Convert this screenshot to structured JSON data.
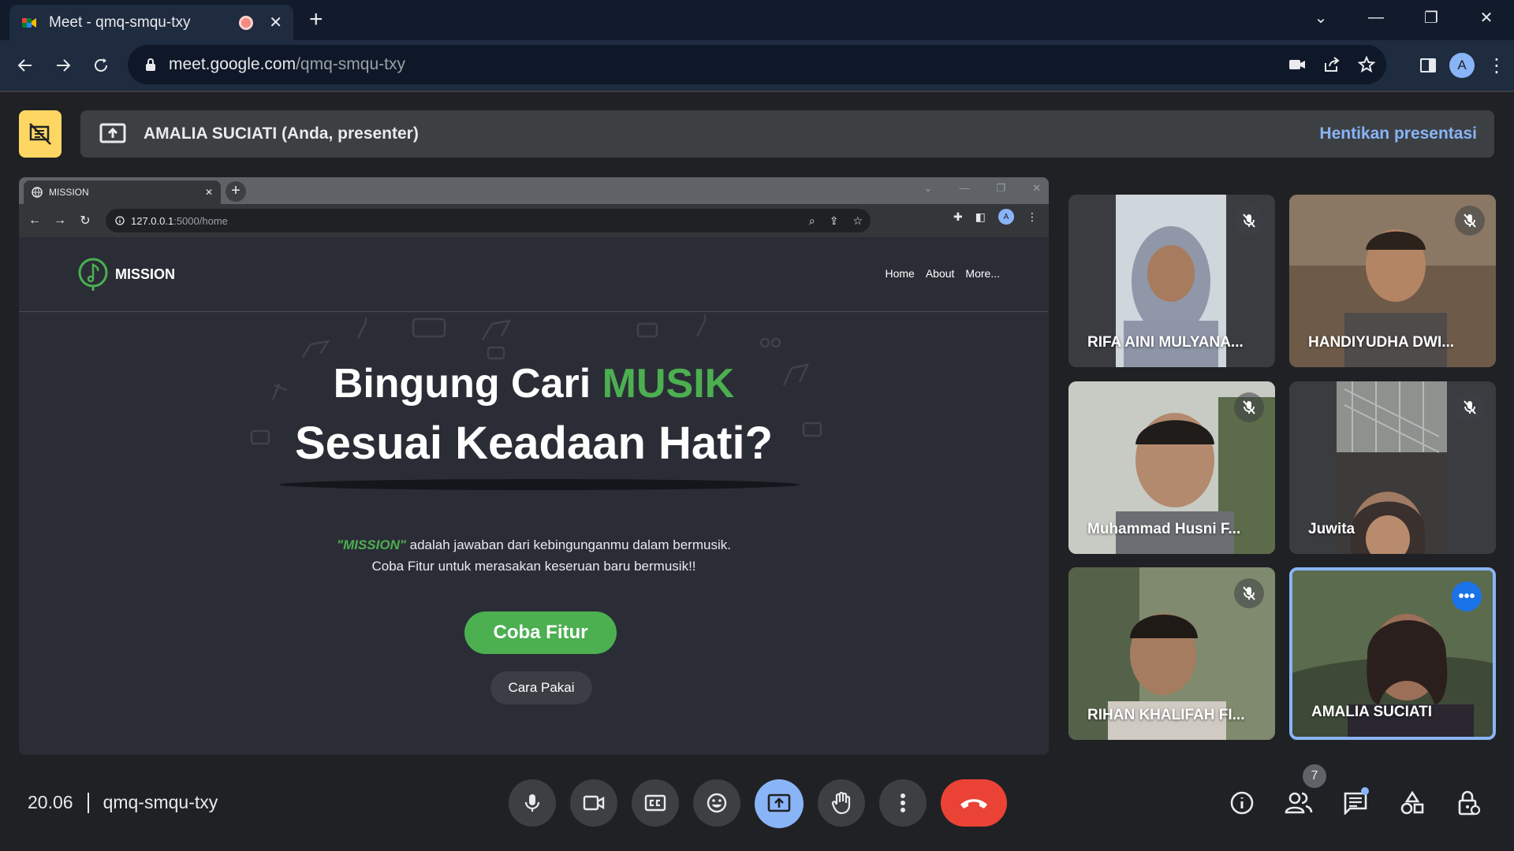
{
  "browser": {
    "tab_title": "Meet - qmq-smqu-txy",
    "url_host": "meet.google.com",
    "url_path": "/qmq-smqu-txy",
    "profile_initial": "A"
  },
  "presenter_bar": {
    "label": "AMALIA SUCIATI (Anda, presenter)",
    "stop_label": "Hentikan presentasi"
  },
  "shared_screen": {
    "tab_title": "MISSION",
    "url_host": "127.0.0.1",
    "url_path": ":5000/home",
    "profile_initial": "A",
    "site": {
      "brand": "MISSION",
      "nav": [
        "Home",
        "About",
        "More..."
      ],
      "hero_line1_pre": "Bingung Cari ",
      "hero_line1_accent": "MUSIK",
      "hero_line2": "Sesuai Keadaan Hati?",
      "desc_em": "\"MISSION\"",
      "desc_rest": " adalah jawaban dari kebingunganmu dalam bermusik.",
      "desc2": "Coba Fitur untuk merasakan keseruan baru bermusik!!",
      "btn_primary": "Coba Fitur",
      "btn_secondary": "Cara Pakai"
    }
  },
  "participants": [
    {
      "name": "RIFA AINI MULYANA...",
      "muted": true
    },
    {
      "name": "HANDIYUDHA DWI...",
      "muted": true
    },
    {
      "name": "Muhammad Husni F...",
      "muted": true
    },
    {
      "name": "Juwita",
      "muted": true
    },
    {
      "name": "RIHAN KHALIFAH FI...",
      "muted": true
    },
    {
      "name": "AMALIA SUCIATI",
      "muted": false
    }
  ],
  "bottom": {
    "time": "20.06",
    "meeting_code": "qmq-smqu-txy",
    "participant_count": "7"
  },
  "colors": {
    "accent_blue": "#8ab4f8",
    "end_call": "#ea4335",
    "present_yellow": "#fdd663",
    "site_green": "#4caf50"
  }
}
